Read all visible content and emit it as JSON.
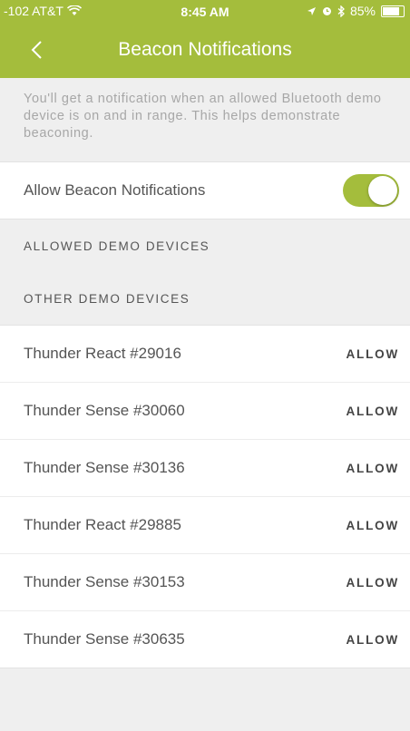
{
  "status_bar": {
    "carrier": "-102 AT&T",
    "time": "8:45 AM",
    "battery": "85%",
    "battery_level": 0.85
  },
  "header": {
    "title": "Beacon Notifications"
  },
  "info_text": "You'll get a notification when an allowed Bluetooth demo device is on and in range. This helps demonstrate beaconing.",
  "toggle": {
    "label": "Allow Beacon Notifications",
    "on": true
  },
  "sections": {
    "allowed_header": "ALLOWED DEMO DEVICES",
    "other_header": "OTHER DEMO DEVICES"
  },
  "devices": [
    {
      "name": "Thunder React #29016",
      "action": "ALLOW"
    },
    {
      "name": "Thunder Sense #30060",
      "action": "ALLOW"
    },
    {
      "name": "Thunder Sense #30136",
      "action": "ALLOW"
    },
    {
      "name": "Thunder React #29885",
      "action": "ALLOW"
    },
    {
      "name": "Thunder Sense #30153",
      "action": "ALLOW"
    },
    {
      "name": "Thunder Sense #30635",
      "action": "ALLOW"
    }
  ],
  "colors": {
    "accent": "#a4bd3c",
    "background": "#efefef",
    "text": "#555555"
  },
  "icons": [
    "wifi-icon",
    "location-arrow-icon",
    "alarm-icon",
    "bluetooth-icon",
    "battery-icon",
    "back-chevron-icon"
  ]
}
